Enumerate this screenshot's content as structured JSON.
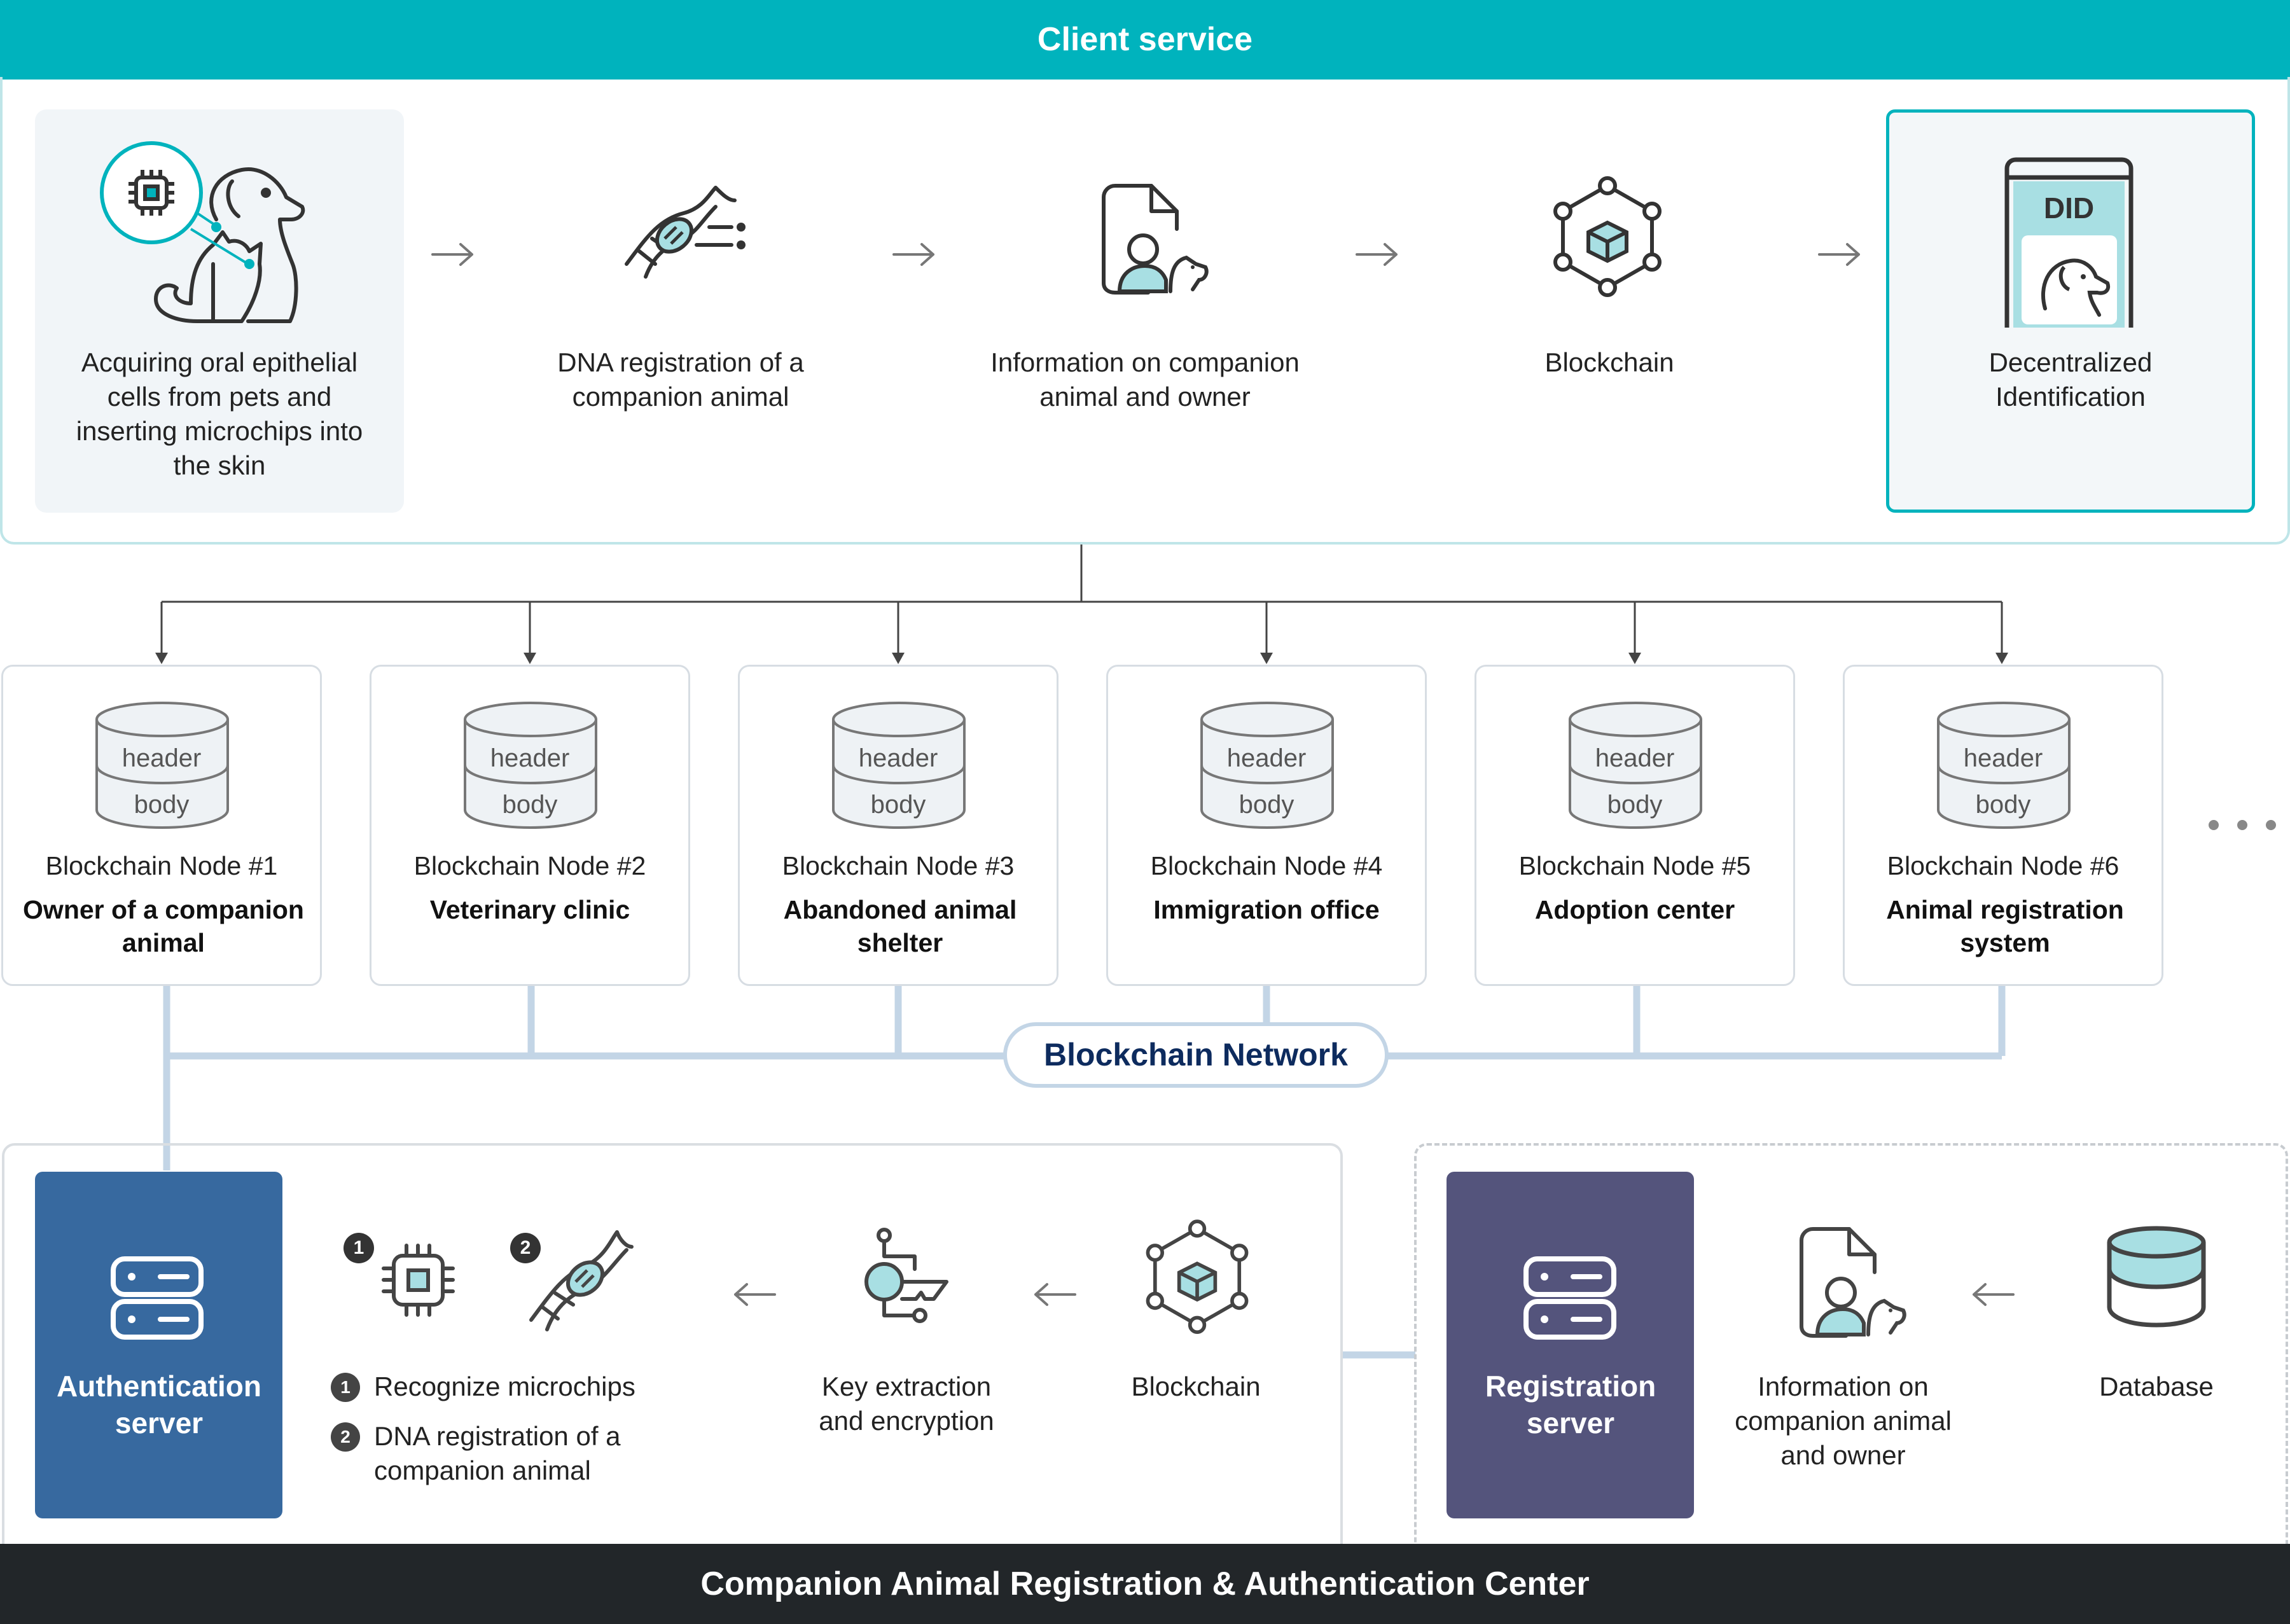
{
  "header": {
    "title": "Client service"
  },
  "footer": {
    "title": "Companion Animal Registration & Authentication Center"
  },
  "flow": {
    "steps": [
      "Acquiring oral epithelial cells from pets and inserting microchips into the skin",
      "DNA registration of a companion animal",
      "Information on companion animal and owner",
      "Blockchain",
      "Decentralized Identification"
    ],
    "did_label": "DID"
  },
  "nodes": [
    {
      "title": "Blockchain Node #1",
      "role": "Owner of a companion animal"
    },
    {
      "title": "Blockchain Node #2",
      "role": "Veterinary clinic"
    },
    {
      "title": "Blockchain Node #3",
      "role": "Abandoned animal shelter"
    },
    {
      "title": "Blockchain Node #4",
      "role": "Immigration office"
    },
    {
      "title": "Blockchain Node #5",
      "role": "Adoption center"
    },
    {
      "title": "Blockchain Node #6",
      "role": "Animal registration system"
    }
  ],
  "db_labels": {
    "header": "header",
    "body": "body"
  },
  "network": {
    "label": "Blockchain Network"
  },
  "auth": {
    "server_label": "Authentication server",
    "badge1": "1",
    "badge2": "2",
    "item1": "Recognize microchips",
    "item2": "DNA registration of a companion animal",
    "key_label": "Key extraction and encryption",
    "blockchain_label": "Blockchain"
  },
  "registration": {
    "server_label": "Registration server",
    "info_label": "Information on companion animal and owner",
    "database_label": "Database"
  },
  "colors": {
    "teal": "#00b3bd",
    "navy": "#0d2b5e",
    "auth_blue": "#37699f",
    "reg_purple": "#54547c",
    "network_line": "#c3d5e6",
    "footer_bg": "#222629"
  }
}
